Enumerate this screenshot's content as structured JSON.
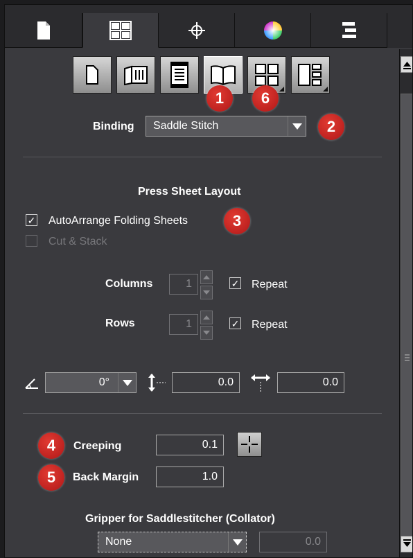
{
  "tabs": [
    {
      "name": "document-icon",
      "active": false
    },
    {
      "name": "layout-icon",
      "active": true
    },
    {
      "name": "crosshair-icon",
      "active": false
    },
    {
      "name": "color-wheel-icon",
      "active": false
    },
    {
      "name": "align-icon",
      "active": false
    }
  ],
  "mode_buttons": [
    {
      "icon": "single-page-icon",
      "active": false
    },
    {
      "icon": "folded-sheet-icon",
      "active": false
    },
    {
      "icon": "strip-layout-icon",
      "active": false
    },
    {
      "icon": "open-book-icon",
      "active": true
    },
    {
      "icon": "grid-2x2-icon",
      "active": false
    },
    {
      "icon": "page-list-icon",
      "active": false
    }
  ],
  "badges": {
    "b1": "1",
    "b2": "2",
    "b3": "3",
    "b4": "4",
    "b5": "5",
    "b6": "6"
  },
  "binding": {
    "label": "Binding",
    "value": "Saddle Stitch"
  },
  "press_sheet": {
    "title": "Press Sheet Layout",
    "auto_arrange": {
      "label": "AutoArrange Folding Sheets",
      "checked": true
    },
    "cut_stack": {
      "label": "Cut & Stack",
      "checked": false,
      "enabled": false
    },
    "columns": {
      "label": "Columns",
      "value": "1",
      "repeat_label": "Repeat",
      "repeat_checked": true
    },
    "rows": {
      "label": "Rows",
      "value": "1",
      "repeat_label": "Repeat",
      "repeat_checked": true
    }
  },
  "transform": {
    "rotation": "0°",
    "vertical_offset": "0.0",
    "horizontal_offset": "0.0"
  },
  "creeping": {
    "label": "Creeping",
    "value": "0.1"
  },
  "back_margin": {
    "label": "Back Margin",
    "value": "1.0"
  },
  "gripper": {
    "label": "Gripper for Saddlestitcher (Collator)",
    "value": "None",
    "amount": "0.0"
  },
  "check_mark": "✓",
  "colors": {
    "panel": "#3a3a3e",
    "badge": "#c8201e",
    "text": "#ffffff",
    "disabled": "#77777b"
  }
}
